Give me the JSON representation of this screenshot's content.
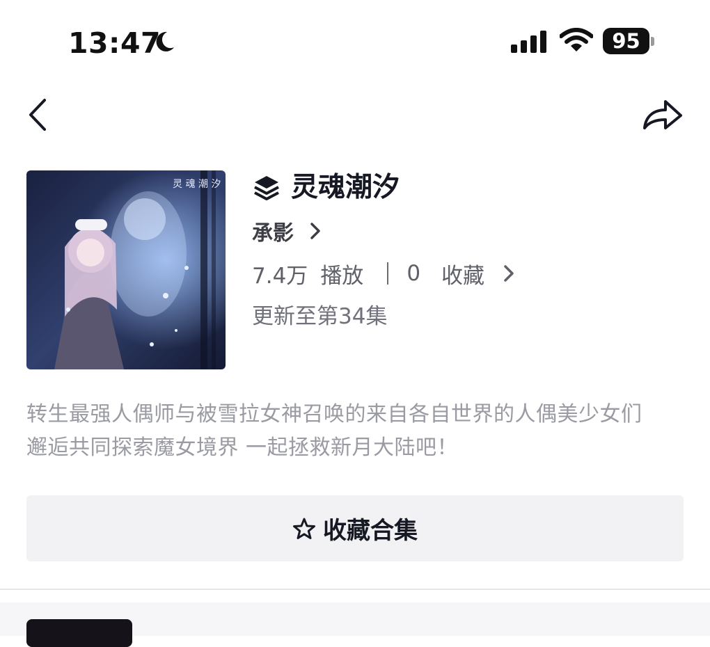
{
  "status_bar": {
    "time": "13:47",
    "battery": "95"
  },
  "album": {
    "title": "灵魂潮汐",
    "author": "承影",
    "plays": "7.4万",
    "plays_label": "播放",
    "favorites": "0",
    "favorites_label": "收藏",
    "update": "更新至第34集",
    "cover_text": "灵 魂 潮 汐"
  },
  "description": {
    "line1": "转生最强人偶师与被雪拉女神召唤的来自各自世界的人偶美少女们",
    "line2": "邂逅共同探索魔女境界 一起拯救新月大陆吧！"
  },
  "actions": {
    "collect_label": "收藏合集"
  },
  "icons": {
    "back": "chevron-left-icon",
    "share": "share-arrow-icon",
    "collection": "layers-icon",
    "collect": "star-outline-icon"
  }
}
